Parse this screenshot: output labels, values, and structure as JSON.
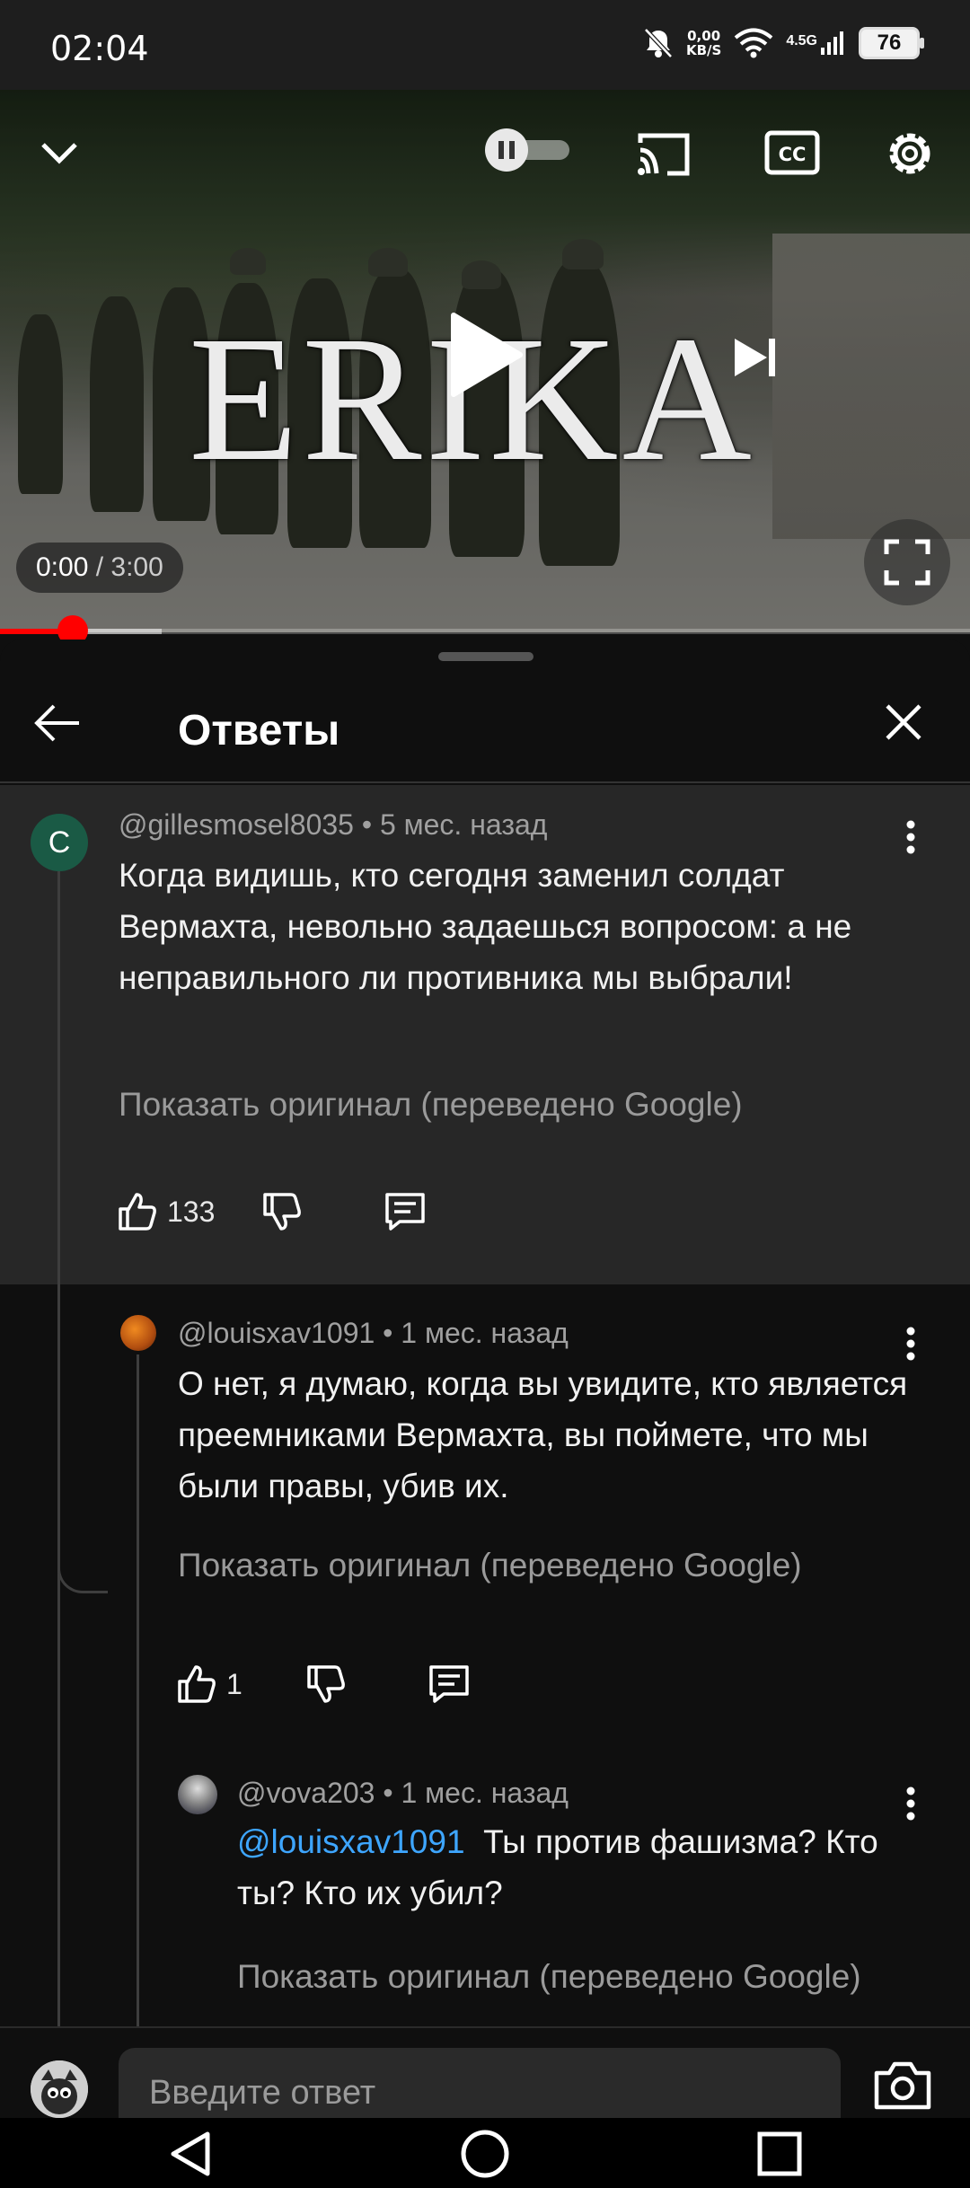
{
  "status_bar": {
    "time": "02:04",
    "net_speed_value": "0,00",
    "net_speed_unit": "KB/S",
    "network_type": "4.5G",
    "battery": "76"
  },
  "video": {
    "title_art": "ERIKA",
    "current_time": "0:00",
    "separator": " / ",
    "duration": "3:00",
    "progress_fraction": 0.075,
    "buffer_fraction": 0.167
  },
  "panel": {
    "title": "Ответы"
  },
  "comments": [
    {
      "author": "@gillesmosel8035",
      "time": "5 мес. назад",
      "avatar_letter": "C",
      "text": "Когда видишь, кто сегодня заменил солдат Вермахта, невольно задаешься вопросом: а не неправильного ли противника мы выбрали!",
      "show_original": "Показать оригинал (переведено Google)",
      "likes": "133"
    },
    {
      "author": "@louisxav1091",
      "time": "1 мес. назад",
      "text": "О нет, я думаю, когда вы увидите, кто является преемниками Вермахта, вы поймете, что мы были правы, убив их.",
      "show_original": "Показать оригинал (переведено Google)",
      "likes": "1"
    },
    {
      "author": "@vova203",
      "time": "1 мес. назад",
      "mention": "@louisxav1091",
      "text": "Ты против фашизма? Кто ты? Кто их убил?",
      "show_original": "Показать оригинал (переведено Google)"
    }
  ],
  "meta_separator": " • ",
  "reply": {
    "placeholder": "Введите ответ"
  },
  "colors": {
    "accent_red": "#ff0000",
    "mention_blue": "#3ea6ff",
    "main_comment_bg": "#272727",
    "background": "#0f0f0f"
  }
}
